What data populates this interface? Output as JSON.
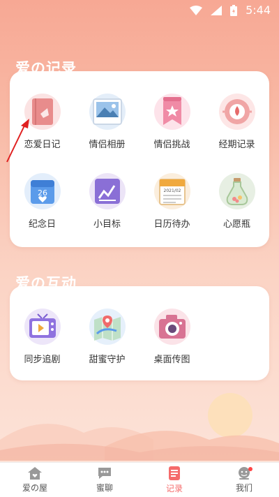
{
  "status_bar": {
    "time": "5:44"
  },
  "section_records": {
    "title": "爱の记录",
    "items": [
      {
        "label": "恋爱日记",
        "icon": "diary-book-icon"
      },
      {
        "label": "情侣相册",
        "icon": "photo-album-icon"
      },
      {
        "label": "情侣挑战",
        "icon": "challenge-banner-icon"
      },
      {
        "label": "经期记录",
        "icon": "period-record-icon"
      },
      {
        "label": "纪念日",
        "icon": "calendar-heart-icon"
      },
      {
        "label": "小目标",
        "icon": "chart-goal-icon"
      },
      {
        "label": "日历待办",
        "icon": "calendar-todo-icon"
      },
      {
        "label": "心愿瓶",
        "icon": "wish-bottle-icon"
      }
    ],
    "calendar_day": "26",
    "calendar_date": "2021/02"
  },
  "section_interact": {
    "title": "爱の互动",
    "items": [
      {
        "label": "同步追剧",
        "icon": "tv-icon"
      },
      {
        "label": "甜蜜守护",
        "icon": "map-location-icon"
      },
      {
        "label": "桌面传图",
        "icon": "camera-icon"
      }
    ]
  },
  "tabbar": {
    "tabs": [
      {
        "label": "爱の屋",
        "icon": "home-heart-icon"
      },
      {
        "label": "蜜聊",
        "icon": "chat-bubble-icon"
      },
      {
        "label": "记录",
        "icon": "record-doc-icon",
        "active": true
      },
      {
        "label": "我们",
        "icon": "profile-icon"
      }
    ]
  },
  "colors": {
    "accent": "#f56b6b",
    "bg_top": "#f7a894"
  }
}
